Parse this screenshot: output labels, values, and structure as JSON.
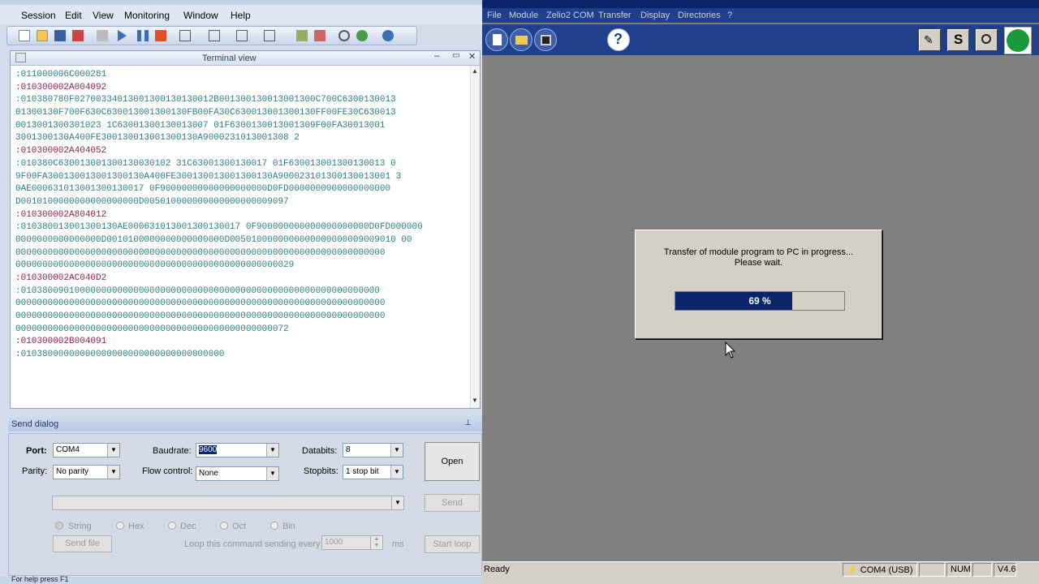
{
  "left_window": {
    "menu": [
      "Session",
      "Edit",
      "View",
      "Monitoring",
      "Window",
      "Help"
    ],
    "terminal_title": "Terminal view",
    "terminal_lines": [
      {
        "text": ":011000006C000281",
        "type": "resp"
      },
      {
        "text": ":010300002A004092",
        "type": "cmd"
      },
      {
        "text": ":010380780F02700334013001300130130012B001300130013001300C700C6300130013",
        "type": "resp"
      },
      {
        "text": "01300130F700F630C630013001300130FB00FA30C630013001300130FF00FE30C630013",
        "type": "resp"
      },
      {
        "text": "0013001300301023 1C63001300130013007 01F6300130013001309F00FA30013001",
        "type": "resp"
      },
      {
        "text": "3001300130A400FE300130013001300130A9000231013001308 2",
        "type": "resp"
      },
      {
        "text": ":010300002A404052",
        "type": "cmd"
      },
      {
        "text": ":010380C630013001300130030102 31C63001300130017 01F630013001300130013 0",
        "type": "resp"
      },
      {
        "text": "9F00FA300130013001300130A400FE300130013001300130A900023101300130013001 3",
        "type": "resp"
      },
      {
        "text": "0AE000631013001300130017 0F90000000000000000000D0FD0000000000000000000",
        "type": "resp"
      },
      {
        "text": "D0010100000000000000000D005010000000000000000009097",
        "type": "resp"
      },
      {
        "text": ":010300002A804012",
        "type": "cmd"
      },
      {
        "text": ":010380013001300130AE000631013001300130017 0F900000000000000000000D0FD000000",
        "type": "resp"
      },
      {
        "text": "0000000000000000D0010100000000000000000D0050100000000000000000009009010 00",
        "type": "resp"
      },
      {
        "text": "000000000000000000000000000000000000000000000000000000000000000000000",
        "type": "resp"
      },
      {
        "text": "0000000000000000000000000000000000000000000000000029",
        "type": "resp"
      },
      {
        "text": ":010300002AC040D2",
        "type": "cmd"
      },
      {
        "text": ":0103800901000000000000000000000000000000000000000000000000000000000",
        "type": "resp"
      },
      {
        "text": "000000000000000000000000000000000000000000000000000000000000000000000",
        "type": "resp"
      },
      {
        "text": "000000000000000000000000000000000000000000000000000000000000000000000",
        "type": "resp"
      },
      {
        "text": "000000000000000000000000000000000000000000000000072",
        "type": "resp"
      },
      {
        "text": ":010300002B004091",
        "type": "cmd"
      },
      {
        "text": ":01038000000000000000000000000000000000",
        "type": "resp"
      }
    ],
    "send_dialog": {
      "title": "Send dialog",
      "port_label": "Port:",
      "port_value": "COM4",
      "baud_label": "Baudrate:",
      "baud_value": "9600",
      "databits_label": "Databits:",
      "databits_value": "8",
      "parity_label": "Parity:",
      "parity_value": "No parity",
      "flow_label": "Flow control:",
      "flow_value": "None",
      "stopbits_label": "Stopbits:",
      "stopbits_value": "1 stop bit",
      "open_label": "Open",
      "send_label": "Send",
      "radios": [
        "String",
        "Hex",
        "Dec",
        "Oct",
        "Bin"
      ],
      "send_file_label": "Send file",
      "loop_label": "Loop this command sending every",
      "loop_value": "1000",
      "loop_unit": "ms",
      "start_loop_label": "Start loop"
    },
    "status": "For help press F1"
  },
  "right_window": {
    "menu": [
      "File",
      "Module",
      "Zelio2 COM",
      "Transfer",
      "Display",
      "Directories",
      "?"
    ],
    "dialog": {
      "line1": "Transfer of module program to PC in progress...",
      "line2": "Please wait.",
      "progress_text": "69 %",
      "progress_fraction": 0.69
    },
    "status": {
      "ready": "Ready",
      "com": "COM4 (USB)",
      "num": "NUM",
      "version": "V4.6"
    }
  },
  "colors": {
    "zelio_blue": "#1f3f8a",
    "progress_fill": "#0a246a",
    "terminal_resp": "#2e7d7d",
    "terminal_cmd": "#8b2252"
  }
}
